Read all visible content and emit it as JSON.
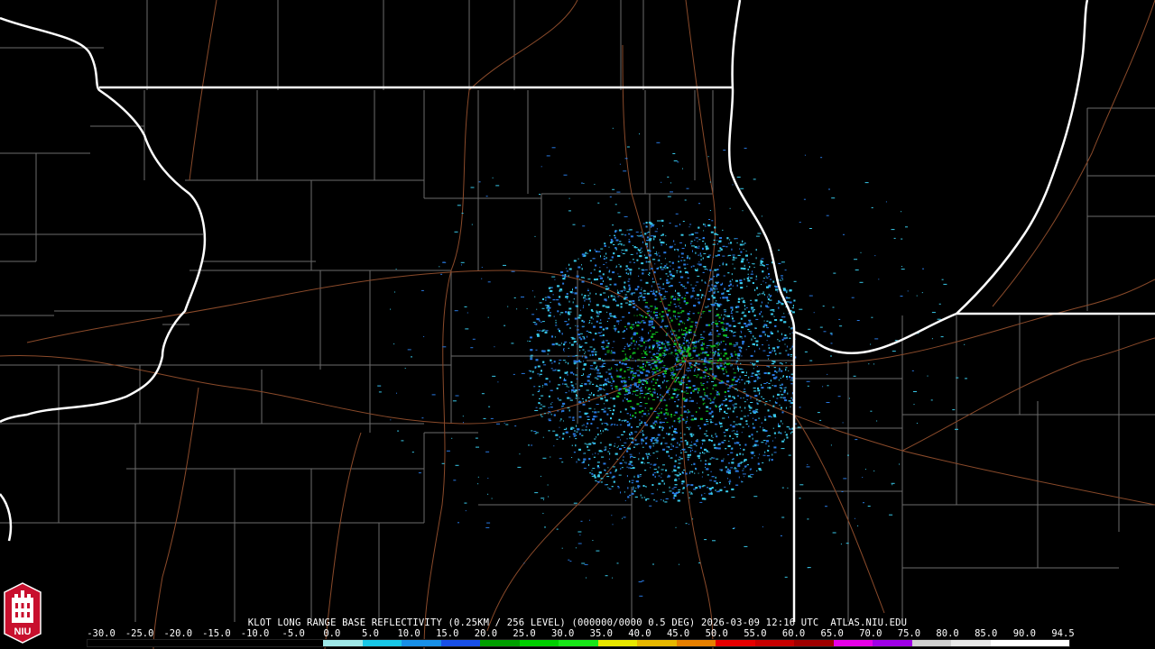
{
  "caption": {
    "text": "KLOT LONG RANGE BASE REFLECTIVITY (0.25KM / 256 LEVEL) (000000/0000 0.5 DEG) 2026-03-09 12:16 UTC  ATLAS.NIU.EDU"
  },
  "logo": {
    "text": "NIU",
    "icon": "niu-tower-logo-icon",
    "color": "#c8102e"
  },
  "colorbar": {
    "ticks": [
      "-30.0",
      "-25.0",
      "-20.0",
      "-15.0",
      "-10.0",
      "-5.0",
      "0.0",
      "5.0",
      "10.0",
      "15.0",
      "20.0",
      "25.0",
      "30.0",
      "35.0",
      "40.0",
      "45.0",
      "50.0",
      "55.0",
      "60.0",
      "65.0",
      "70.0",
      "75.0",
      "80.0",
      "85.0",
      "90.0",
      "94.5"
    ],
    "colors": [
      "#000000",
      "#000000",
      "#000000",
      "#000000",
      "#000000",
      "#000000",
      "#9fe8e8",
      "#18c8e8",
      "#1890e8",
      "#1850e8",
      "#00a000",
      "#00d000",
      "#18e818",
      "#e8e800",
      "#e8b800",
      "#e88000",
      "#e80000",
      "#c80000",
      "#a00000",
      "#e800e8",
      "#a000e8",
      "#d0d0d0",
      "#e8e8e8",
      "#ffffff",
      "#ffffff"
    ]
  },
  "colors": {
    "background": "#000000",
    "state_border": "#ffffff",
    "county_line": "#6b6b6b",
    "road": "#8a4a2a",
    "echo_light": "#38c8e8",
    "echo_mid": "#2878e0",
    "echo_green": "#10b820"
  }
}
